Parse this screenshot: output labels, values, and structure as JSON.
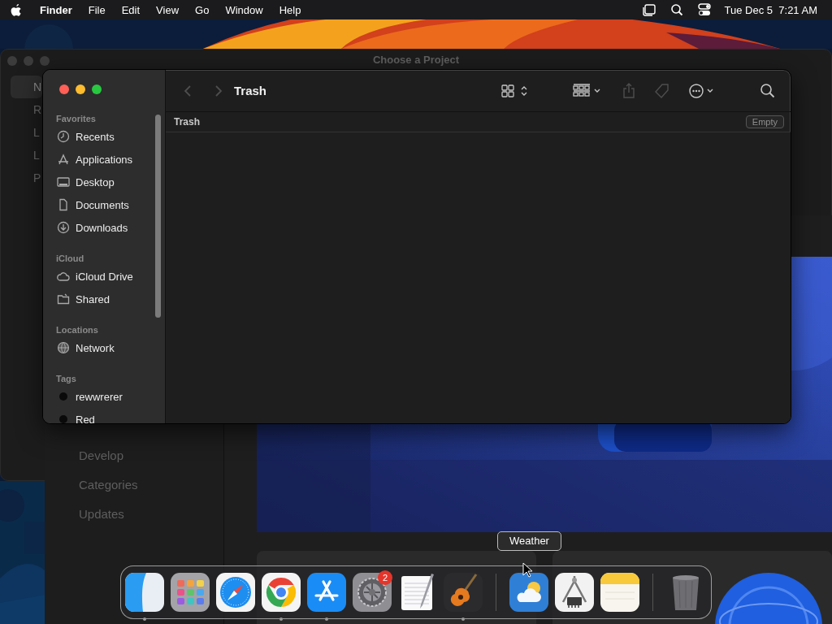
{
  "menu_bar": {
    "items": [
      {
        "label": "Finder",
        "kind": "app"
      },
      {
        "label": "File",
        "kind": "menu"
      },
      {
        "label": "Edit",
        "kind": "menu"
      },
      {
        "label": "View",
        "kind": "menu"
      },
      {
        "label": "Go",
        "kind": "menu"
      },
      {
        "label": "Window",
        "kind": "menu"
      },
      {
        "label": "Help",
        "kind": "menu"
      }
    ],
    "status_icons": [
      {
        "kind": "stage"
      },
      {
        "kind": "search"
      },
      {
        "kind": "control"
      }
    ],
    "clock": "Tue Dec 5  7:21 AM"
  },
  "project_window": {
    "title": "Choose a Project",
    "sidebar_items": [
      {
        "label": "N",
        "selected": true
      },
      {
        "label": "R",
        "selected": false
      },
      {
        "label": "L",
        "selected": false
      },
      {
        "label": "L",
        "selected": false
      },
      {
        "label": "P",
        "selected": false
      }
    ]
  },
  "store_window": {
    "sidebar_items": [
      "Develop",
      "Categories",
      "Updates"
    ]
  },
  "finder": {
    "title": "Trash",
    "path": "Trash",
    "empty_button": "Empty",
    "toolbar": [
      {
        "kind": "back",
        "disabled": true
      },
      {
        "kind": "forward",
        "disabled": true
      },
      {
        "kind": "view",
        "disabled": false
      },
      {
        "kind": "group",
        "disabled": false
      },
      {
        "kind": "share",
        "disabled": true
      },
      {
        "kind": "tag",
        "disabled": true
      },
      {
        "kind": "more",
        "disabled": false
      },
      {
        "kind": "search",
        "disabled": false
      }
    ],
    "sidebar": [
      {
        "header": "Favorites",
        "items": [
          {
            "label": "Recents",
            "kind": "place"
          },
          {
            "label": "Applications",
            "kind": "place"
          },
          {
            "label": "Desktop",
            "kind": "place"
          },
          {
            "label": "Documents",
            "kind": "place"
          },
          {
            "label": "Downloads",
            "kind": "place"
          }
        ]
      },
      {
        "header": "iCloud",
        "items": [
          {
            "label": "iCloud Drive",
            "kind": "place"
          },
          {
            "label": "Shared",
            "kind": "place"
          }
        ]
      },
      {
        "header": "Locations",
        "items": [
          {
            "label": "Network",
            "kind": "place"
          }
        ]
      },
      {
        "header": "Tags",
        "items": [
          {
            "label": "rewwrerer",
            "kind": "tag",
            "color": "#0a0a0a"
          },
          {
            "label": "Red",
            "kind": "tag",
            "color": "#0a0a0a"
          }
        ]
      }
    ]
  },
  "dock": {
    "tooltip": "Weather",
    "items": [
      {
        "kind": "finder",
        "running": true
      },
      {
        "kind": "launchpad",
        "running": false
      },
      {
        "kind": "safari",
        "running": false
      },
      {
        "kind": "chrome",
        "running": true
      },
      {
        "kind": "appstore",
        "running": true
      },
      {
        "kind": "settings",
        "running": false,
        "badge": "2"
      },
      {
        "kind": "textedit",
        "running": false
      },
      {
        "kind": "garageband",
        "running": true
      },
      {
        "kind": "separator"
      },
      {
        "kind": "weather",
        "running": false
      },
      {
        "kind": "caliper",
        "running": false
      },
      {
        "kind": "notes",
        "running": false
      },
      {
        "kind": "separator"
      },
      {
        "kind": "trash",
        "running": false
      }
    ]
  }
}
